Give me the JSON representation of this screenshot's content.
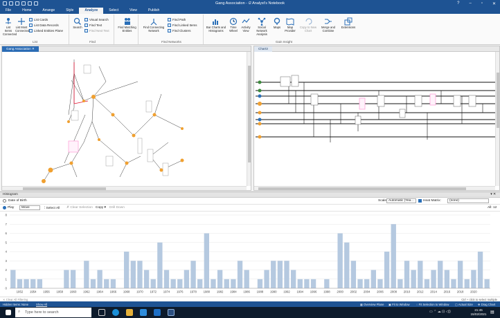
{
  "window": {
    "title": "Gang Association - i2 Analyst's Notebook",
    "controls": [
      "?",
      "–",
      "▫",
      "✕"
    ]
  },
  "ribbon_tabs": [
    "File",
    "Home",
    "Arrange",
    "Style",
    "Analyze",
    "Select",
    "View",
    "Publish"
  ],
  "ribbon_active_tab": "Analyze",
  "ribbon": {
    "list": {
      "list_items_connected": "List Items Connected",
      "list_most_connected": "List Most Connected",
      "list_cards": "List Cards",
      "list_data_records": "List Data Records",
      "linked_entities_plane": "Linked Entities Plane",
      "label": "List"
    },
    "find": {
      "search": "Search",
      "visual_search": "Visual Search",
      "find_text": "Find Text",
      "find_next_text": "Find Next Text",
      "label": "Find"
    },
    "find_matching": "Find Matching Entities",
    "networks": {
      "find_connecting": "Find Connecting Network",
      "find_path": "Find Path",
      "find_linked_items": "Find Linked Items",
      "find_clusters": "Find Clusters",
      "label": "Find Networks"
    },
    "gain": {
      "bar_charts": "Bar Charts and Histograms",
      "time_wheel": "Time Wheel",
      "activity_view": "Activity View",
      "sna": "Social Network Analysis",
      "maps": "Maps",
      "map_provider": "Map Provider",
      "copy_new_chart": "Copy to New Chart",
      "merge_combine": "Merge and Combine",
      "extensions": "Extensions",
      "label": "Gain Insight"
    }
  },
  "pane_left": {
    "tab": "Gang Association"
  },
  "pane_right": {
    "tab": "Chart3"
  },
  "histogram": {
    "title": "Histogram",
    "attribute": "Date of Birth",
    "scale_label": "Scale:",
    "scale_value": "Automatic (Yea…",
    "heat_matrix_label": "Heat Matrix:",
    "heat_matrix_value": "(none)",
    "play": "Play",
    "mode": "Move",
    "select_all": "Select All",
    "clear_selection": "Clear Selection",
    "copy": "Copy",
    "drill_down": "Drill Down",
    "all_count": "All: 12",
    "clear_filtering": "Clear All Filtering",
    "ctrl_hint": "Ctrl + click to select multiple"
  },
  "chart_data": {
    "type": "bar",
    "title": "",
    "xlabel": "",
    "ylabel": "",
    "ylim": [
      0,
      8
    ],
    "yticks": [
      0,
      1,
      2,
      3,
      4,
      5,
      6,
      7,
      8
    ],
    "x_tick_labels": [
      "1952",
      "1954",
      "1956",
      "1958",
      "1960",
      "1962",
      "1964",
      "1966",
      "1968",
      "1970",
      "1972",
      "1974",
      "1976",
      "1978",
      "1980",
      "1982",
      "1984",
      "1986",
      "1988",
      "1990",
      "1992",
      "1994",
      "1996",
      "1998",
      "2000",
      "2002",
      "2004",
      "2006",
      "2008",
      "2010",
      "2012",
      "2014",
      "2016",
      "2018",
      "2020"
    ],
    "categories": [
      "1951",
      "1952",
      "1953",
      "1954",
      "1955",
      "1956",
      "1957",
      "1958",
      "1959",
      "1960",
      "1961",
      "1962",
      "1963",
      "1964",
      "1965",
      "1966",
      "1967",
      "1968",
      "1969",
      "1970",
      "1971",
      "1972",
      "1973",
      "1974",
      "1975",
      "1976",
      "1977",
      "1978",
      "1979",
      "1980",
      "1981",
      "1982",
      "1983",
      "1984",
      "1985",
      "1986",
      "1987",
      "1988",
      "1989",
      "1990",
      "1991",
      "1992",
      "1993",
      "1994",
      "1995",
      "1996",
      "1997",
      "1998",
      "1999",
      "2000",
      "2001",
      "2002",
      "2003",
      "2004",
      "2005",
      "2006",
      "2007",
      "2008",
      "2009",
      "2010",
      "2011",
      "2012",
      "2013",
      "2014",
      "2015",
      "2016",
      "2017",
      "2018",
      "2019",
      "2020",
      "2021",
      "2022"
    ],
    "values": [
      2,
      1,
      1,
      1,
      1,
      0,
      0,
      0,
      2,
      2,
      0,
      3,
      1,
      2,
      1,
      1,
      0,
      4,
      3,
      3,
      2,
      1,
      5,
      2,
      1,
      1,
      2,
      3,
      1,
      6,
      1,
      2,
      1,
      1,
      3,
      2,
      0,
      1,
      2,
      3,
      3,
      3,
      2,
      1,
      1,
      1,
      0,
      1,
      0,
      6,
      5,
      3,
      1,
      1,
      2,
      1,
      4,
      7,
      1,
      3,
      2,
      3,
      1,
      2,
      3,
      2,
      1,
      3,
      1,
      2,
      4,
      1
    ],
    "bar_color": "#b5c9e0"
  },
  "statusbar": {
    "left1": "Hidden Items: None",
    "left2": "Show All",
    "r1": "Overview Plane",
    "r2": "Fit to Window",
    "r3": "Fit Selection to Window",
    "r4": "Actual Size",
    "r5": "Drag Chart"
  },
  "taskbar": {
    "search_placeholder": "Type here to search",
    "time": "21:45",
    "date": "15/02/2021"
  },
  "colors": {
    "accent": "#1e5393",
    "link": "#1a1a1a",
    "entity_orange": "#f0a030",
    "highlight_pink": "#ff9ad6"
  }
}
